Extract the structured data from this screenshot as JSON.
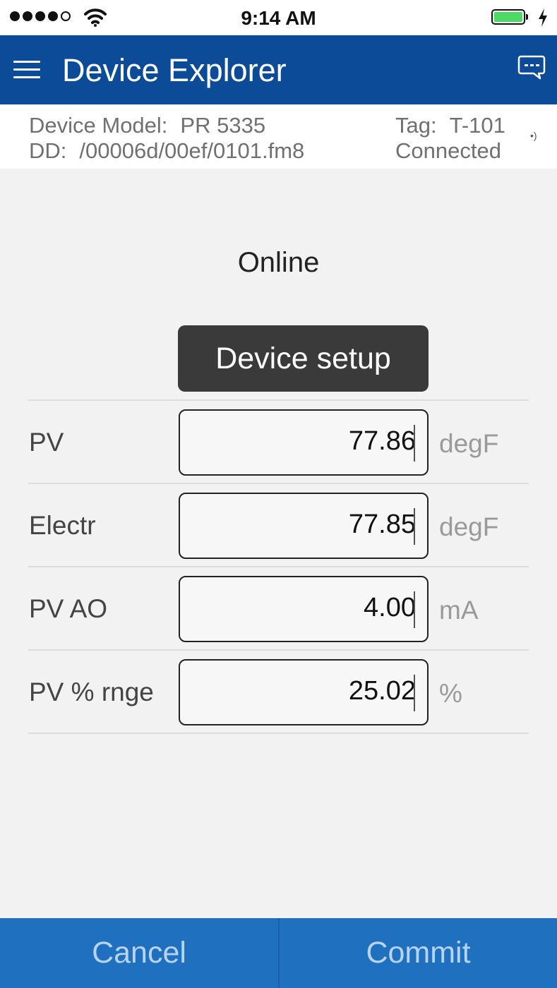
{
  "status_bar": {
    "time": "9:14 AM",
    "signal_icon": "cellular-signal-icon",
    "wifi_icon": "wifi-icon",
    "battery_icon": "battery-icon",
    "battery_level": 1.0,
    "charging_icon": "charging-bolt-icon"
  },
  "header": {
    "title": "Device Explorer",
    "menu_icon": "hamburger-menu-icon",
    "chat_icon": "chat-bubble-icon",
    "background": "#0c4b97"
  },
  "device_info": {
    "model_label": "Device Model:",
    "model_value": "PR 5335",
    "dd_label": "DD:",
    "dd_value": "/00006d/00ef/0101.fm8",
    "tag_label": "Tag:",
    "tag_value": "T-101",
    "status": "Connected",
    "connection_icon": "signal-wave-icon"
  },
  "main": {
    "heading": "Online",
    "setup_button": "Device setup",
    "fields": [
      {
        "label": "PV",
        "value": "77.86",
        "unit": "degF"
      },
      {
        "label": "Electr",
        "value": "77.85",
        "unit": "degF"
      },
      {
        "label": "PV AO",
        "value": "4.00",
        "unit": "mA"
      },
      {
        "label": "PV % rnge",
        "value": "25.02",
        "unit": "%"
      }
    ]
  },
  "footer": {
    "cancel_label": "Cancel",
    "commit_label": "Commit",
    "background": "#1f70bf"
  }
}
